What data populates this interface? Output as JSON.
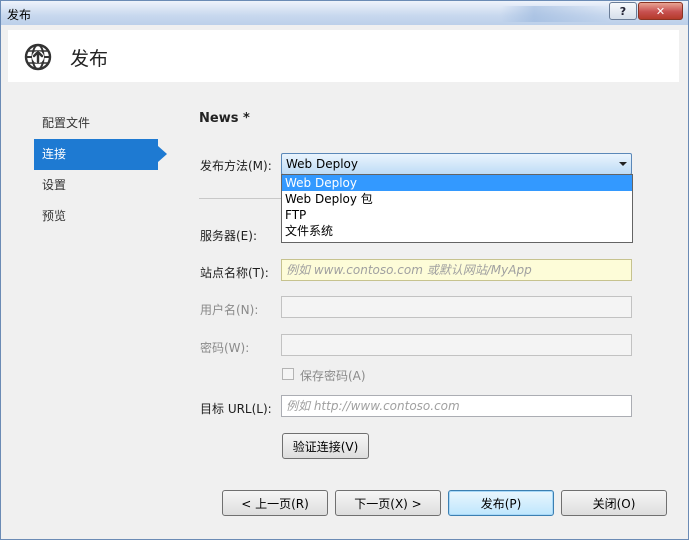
{
  "window": {
    "title": "发布"
  },
  "header": {
    "title": "发布",
    "icon": "globe-publish-icon"
  },
  "nav": {
    "items": [
      {
        "label": "配置文件"
      },
      {
        "label": "连接"
      },
      {
        "label": "设置"
      },
      {
        "label": "预览"
      }
    ],
    "active": "连接"
  },
  "profile": {
    "name": "News *"
  },
  "form": {
    "publish_method": {
      "label": "发布方法(M):",
      "value": "Web Deploy"
    },
    "publish_method_options": [
      "Web Deploy",
      "Web Deploy 包",
      "FTP",
      "文件系统"
    ],
    "server": {
      "label": "服务器(E):",
      "value": ""
    },
    "site_name": {
      "label": "站点名称(T):",
      "placeholder": "例如 www.contoso.com 或默认网站/MyApp"
    },
    "username": {
      "label": "用户名(N):",
      "value": ""
    },
    "password": {
      "label": "密码(W):",
      "value": ""
    },
    "save_password": {
      "label": "保存密码(A)",
      "checked": false
    },
    "target_url": {
      "label": "目标 URL(L):",
      "placeholder": "例如 http://www.contoso.com"
    },
    "validate_button": "验证连接(V)"
  },
  "footer": {
    "prev": "< 上一页(R)",
    "next": "下一页(X) >",
    "publish": "发布(P)",
    "close": "关闭(O)"
  },
  "titlebar_buttons": {
    "help": "?",
    "close": "✕"
  },
  "colors": {
    "accent": "#1e7ad2",
    "selection": "#3399ff",
    "highlight_field": "#fdfcd8"
  }
}
